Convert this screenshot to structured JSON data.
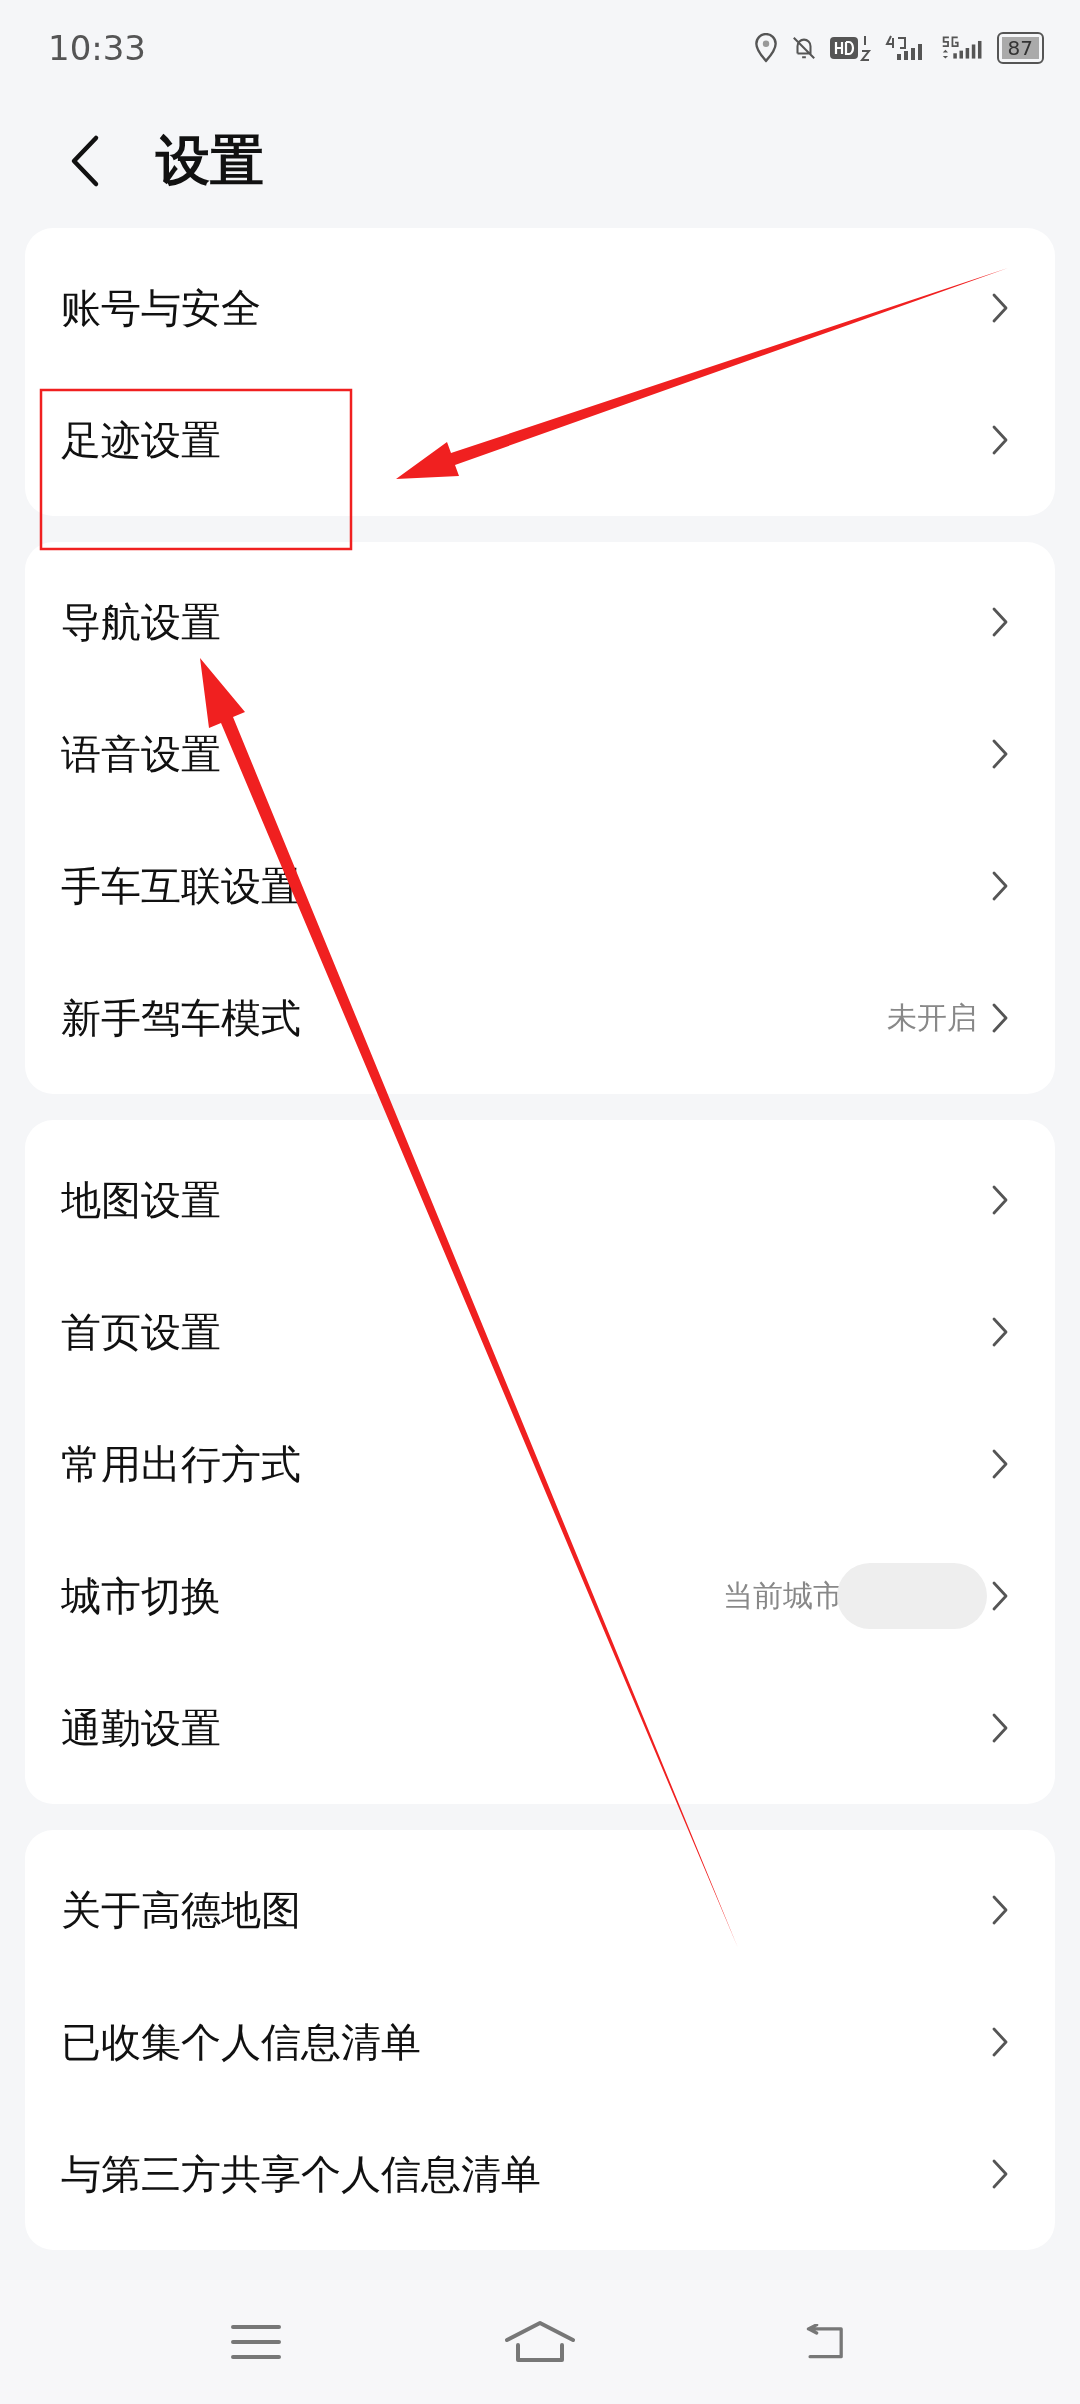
{
  "status_bar": {
    "time": "10:33",
    "battery": "87"
  },
  "header": {
    "title": "设置"
  },
  "groups": [
    {
      "items": [
        {
          "label": "账号与安全"
        },
        {
          "label": "足迹设置"
        }
      ]
    },
    {
      "items": [
        {
          "label": "导航设置"
        },
        {
          "label": "语音设置"
        },
        {
          "label": "手车互联设置"
        },
        {
          "label": "新手驾车模式",
          "value": "未开启"
        }
      ]
    },
    {
      "items": [
        {
          "label": "地图设置"
        },
        {
          "label": "首页设置"
        },
        {
          "label": "常用出行方式"
        },
        {
          "label": "城市切换",
          "value": "当前城市",
          "redacted": true
        },
        {
          "label": "通勤设置"
        }
      ]
    },
    {
      "items": [
        {
          "label": "关于高德地图"
        },
        {
          "label": "已收集个人信息清单"
        },
        {
          "label": "与第三方共享个人信息清单"
        }
      ]
    }
  ]
}
